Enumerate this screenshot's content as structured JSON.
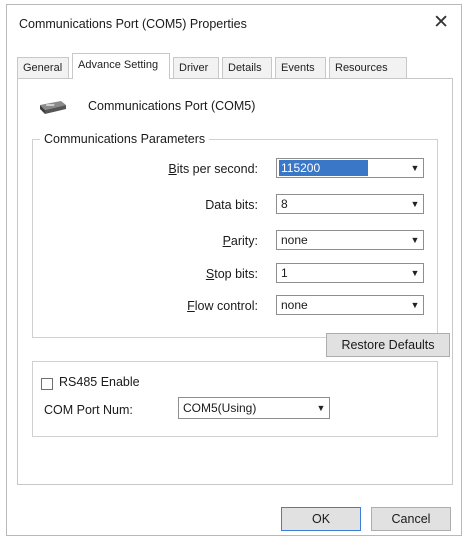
{
  "window": {
    "title": "Communications Port (COM5) Properties",
    "close_glyph": "✕"
  },
  "tabs": [
    {
      "label": "General",
      "active": false
    },
    {
      "label": "Advance Setting",
      "active": true
    },
    {
      "label": "Driver",
      "active": false
    },
    {
      "label": "Details",
      "active": false
    },
    {
      "label": "Events",
      "active": false
    },
    {
      "label": "Resources",
      "active": false
    }
  ],
  "device": {
    "icon": "serial-port-icon",
    "name": "Communications Port (COM5)"
  },
  "params": {
    "legend": "Communications Parameters",
    "rows": [
      {
        "label_accel": "B",
        "label_rest": "its per second:",
        "value": "115200",
        "selected": true
      },
      {
        "label_accel": "",
        "label_rest": "Data bits:",
        "value": "8",
        "selected": false
      },
      {
        "label_accel": "P",
        "label_rest": "arity:",
        "value": "none",
        "selected": false
      },
      {
        "label_accel": "S",
        "label_rest": "top bits:",
        "value": "1",
        "selected": false
      },
      {
        "label_accel": "F",
        "label_rest": "low control:",
        "value": "none",
        "selected": false
      }
    ],
    "restore_button": "Restore Defaults"
  },
  "rs485": {
    "checkbox_label": "RS485 Enable",
    "checked": false,
    "com_port_label": "COM Port Num:",
    "com_port_value": "COM5(Using)"
  },
  "footer": {
    "ok": "OK",
    "cancel": "Cancel"
  },
  "colors": {
    "selection": "#3a77c7",
    "default_button_border": "#3c7fd6"
  }
}
